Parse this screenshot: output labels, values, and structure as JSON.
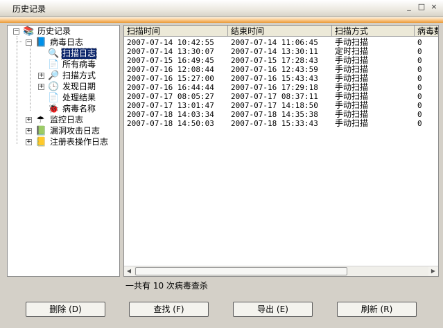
{
  "window": {
    "title": "历史记录",
    "controls": {
      "minimize": "_",
      "maximize": "□",
      "close": "×"
    }
  },
  "tree": {
    "root": {
      "label": "历史记录",
      "icon": "books-icon",
      "expander": "−"
    },
    "virus_log": {
      "label": "病毒日志",
      "icon": "book-icon",
      "expander": "−"
    },
    "children": [
      {
        "label": "扫描日志",
        "icon": "scan-log-icon",
        "selected": true
      },
      {
        "label": "所有病毒",
        "icon": "document-icon"
      },
      {
        "label": "扫描方式",
        "icon": "magnifier-icon",
        "expander": "+"
      },
      {
        "label": "发现日期",
        "icon": "calendar-clock-icon",
        "expander": "+"
      },
      {
        "label": "处理结果",
        "icon": "document-icon"
      },
      {
        "label": "病毒名称",
        "icon": "bug-document-icon"
      }
    ],
    "others": [
      {
        "label": "监控日志",
        "icon": "umbrella-icon",
        "expander": "+"
      },
      {
        "label": "漏洞攻击日志",
        "icon": "shield-book-icon",
        "expander": "+"
      },
      {
        "label": "注册表操作日志",
        "icon": "registry-books-icon",
        "expander": "+"
      }
    ]
  },
  "table": {
    "columns": [
      "扫描时间",
      "结束时间",
      "扫描方式",
      "病毒数"
    ],
    "rows": [
      [
        "2007-07-14 10:42:55",
        "2007-07-14 11:06:45",
        "手动扫描",
        "0"
      ],
      [
        "2007-07-14 13:30:07",
        "2007-07-14 13:30:11",
        "定时扫描",
        "0"
      ],
      [
        "2007-07-15 16:49:45",
        "2007-07-15 17:28:43",
        "手动扫描",
        "0"
      ],
      [
        "2007-07-16 12:08:44",
        "2007-07-16 12:43:59",
        "手动扫描",
        "0"
      ],
      [
        "2007-07-16 15:27:00",
        "2007-07-16 15:43:43",
        "手动扫描",
        "0"
      ],
      [
        "2007-07-16 16:44:44",
        "2007-07-16 17:29:18",
        "手动扫描",
        "0"
      ],
      [
        "2007-07-17 08:05:27",
        "2007-07-17 08:37:11",
        "手动扫描",
        "0"
      ],
      [
        "2007-07-17 13:01:47",
        "2007-07-17 14:18:50",
        "手动扫描",
        "0"
      ],
      [
        "2007-07-18 14:03:34",
        "2007-07-18 14:35:38",
        "手动扫描",
        "0"
      ],
      [
        "2007-07-18 14:50:03",
        "2007-07-18 15:33:43",
        "手动扫描",
        "0"
      ]
    ]
  },
  "scrollbar": {
    "left_arrow": "◀",
    "right_arrow": "▶"
  },
  "status_text": "一共有 10 次病毒查杀",
  "buttons": {
    "delete": "删除 (D)",
    "find": "查找 (F)",
    "export": "导出 (E)",
    "refresh": "刷新 (R)"
  },
  "colors": {
    "selection": "#0a246a",
    "accent": "#f5b466"
  }
}
